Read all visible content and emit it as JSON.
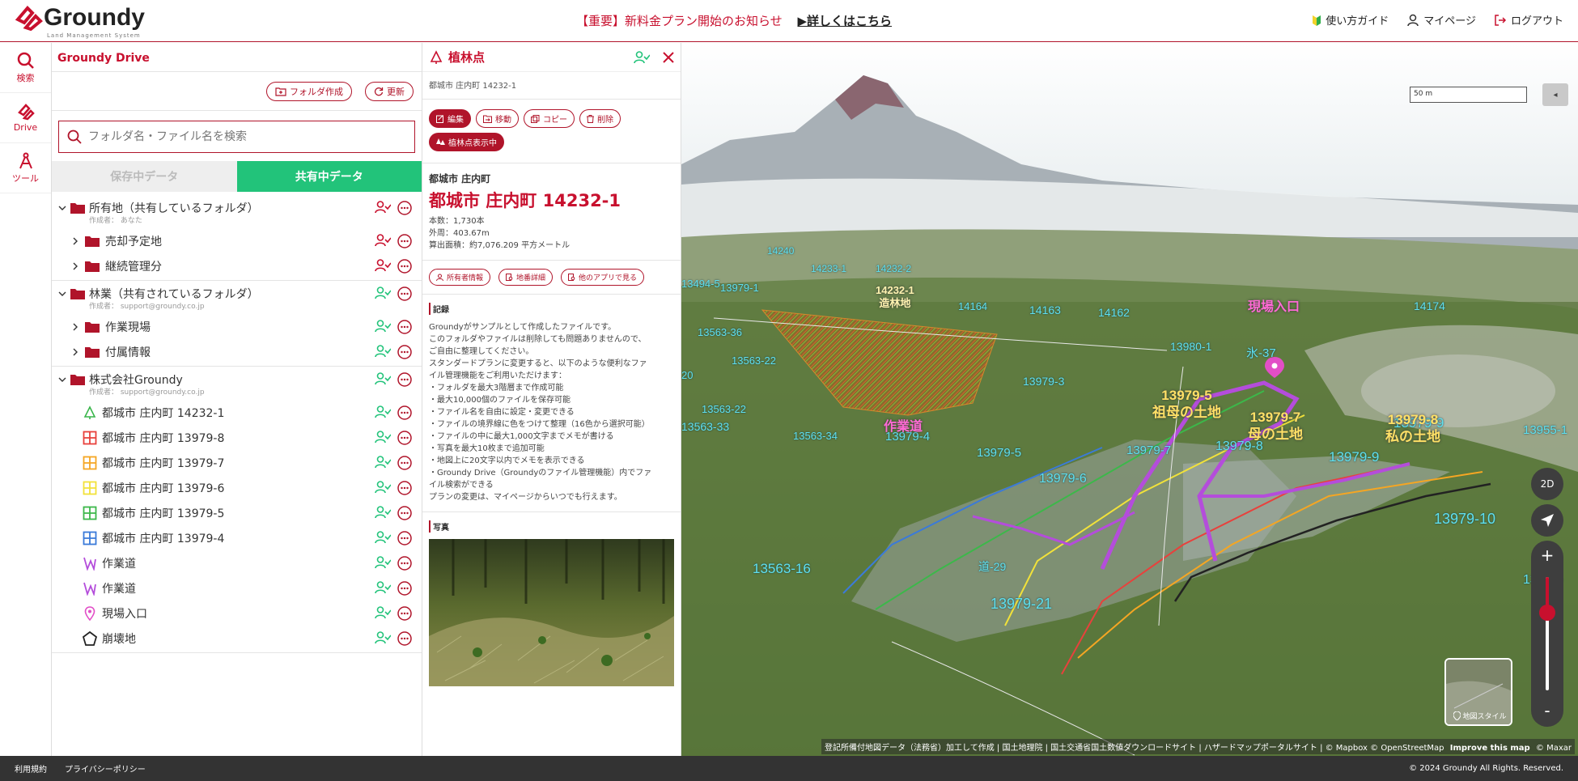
{
  "header": {
    "logo_text": "Groundy",
    "logo_sub": "Land Management System",
    "notice_text": "【重要】新料金プラン開始のお知らせ",
    "notice_link": "▶詳しくはこちら",
    "nav": {
      "guide": "使い方ガイド",
      "mypage": "マイページ",
      "logout": "ログアウト"
    }
  },
  "rail": {
    "search": "検索",
    "drive": "Drive",
    "tools": "ツール"
  },
  "drive": {
    "title": "Groundy Drive",
    "create_folder": "フォルダ作成",
    "refresh": "更新",
    "search_placeholder": "フォルダ名・ファイル名を検索",
    "tab_saved": "保存中データ",
    "tab_shared": "共有中データ",
    "group1": {
      "name": "所有地（共有しているフォルダ）",
      "owner": "作成者： あなた",
      "children": [
        "売却予定地",
        "継続管理分"
      ]
    },
    "group2": {
      "name": "林業（共有されているフォルダ）",
      "owner": "作成者： support@groundy.co.jp",
      "children": [
        "作業現場",
        "付属情報"
      ]
    },
    "group3": {
      "name": "株式会社Groundy",
      "owner": "作成者： support@groundy.co.jp",
      "files": [
        {
          "label": "都城市 庄内町 14232-1",
          "color": "#39b54a"
        },
        {
          "label": "都城市 庄内町 13979-8",
          "color": "#e8413c"
        },
        {
          "label": "都城市 庄内町 13979-7",
          "color": "#f5a623"
        },
        {
          "label": "都城市 庄内町 13979-6",
          "color": "#f2e23a"
        },
        {
          "label": "都城市 庄内町 13979-5",
          "color": "#3cb84a"
        },
        {
          "label": "都城市 庄内町 13979-4",
          "color": "#3b7ad9"
        },
        {
          "label": "作業道",
          "color": "#b44ddb"
        },
        {
          "label": "作業道",
          "color": "#b44ddb"
        },
        {
          "label": "現場入口",
          "color": "#e24ec7"
        },
        {
          "label": "崩壊地",
          "color": "#222222"
        }
      ]
    }
  },
  "detail": {
    "title": "植林点",
    "subtitle": "都城市 庄内町 14232-1",
    "btn_edit": "編集",
    "btn_move": "移動",
    "btn_copy": "コピー",
    "btn_delete": "削除",
    "btn_show": "植林点表示中",
    "pref": "都城市 庄内町",
    "name": "都城市 庄内町 14232-1",
    "count": "本数：1,730本",
    "perimeter": "外周：403.67m",
    "area": "算出面積：約7,076.209 平方メートル",
    "btn_owner": "所有者情報",
    "btn_parcel": "地番詳細",
    "btn_otherapp": "他のアプリで見る",
    "record_label": "記録",
    "record_lines": [
      "Groundyがサンプルとして作成したファイルです。",
      "このフォルダやファイルは削除しても問題ありませんので、",
      "ご自由に整理してください。",
      "スタンダードプランに変更すると、以下のような便利なファ",
      "イル管理機能をご利用いただけます：",
      "・フォルダを最大3階層まで作成可能",
      "・最大10,000個のファイルを保存可能",
      "・ファイル名を自由に設定・変更できる",
      "・ファイルの境界線に色をつけて整理（16色から選択可能）",
      "・ファイルの中に最大1,000文字までメモが書ける",
      "・写真を最大10枚まで追加可能",
      "・地図上に20文字以内でメモを表示できる",
      "・Groundy Drive（Groundyのファイル管理機能）内でファ",
      "イル検索ができる",
      "プランの変更は、マイページからいつでも行えます。"
    ],
    "photo_label": "写真"
  },
  "map": {
    "scale": "50 m",
    "btn_2d": "2D",
    "zoom_in": "+",
    "zoom_out": "-",
    "style_label": "地図スタイル",
    "attribution": "登記所備付地図データ（法務省）加工して作成 | 国土地理院 | 国土交通省国土数値ダウンロードサイト | ハザードマップポータルサイト | © Mapbox © OpenStreetMap",
    "attribution_improve": "Improve this map",
    "attribution_maxar": "© Maxar",
    "labels_cyan": [
      "13979-1",
      "14233-1",
      "14232-2",
      "14164",
      "14163",
      "14162",
      "13563-36",
      "13563-22",
      "13979-3",
      "13980-1",
      "氷-37",
      "13563-22",
      "13979-4",
      "13563-33",
      "13563-34",
      "13979-5",
      "13979-6",
      "13979-7",
      "13979-8",
      "13979-9",
      "13979-9",
      "13979-10",
      "13563-16",
      "13979-21",
      "道-29",
      "14174",
      "14240",
      "13494-5",
      "20",
      "13955-1",
      "13979-"
    ],
    "labels_yellow": [
      "14232-1\n造林地",
      "13979-5\n祖母の土地",
      "13979-7\n母の土地",
      "13979-8\n私の土地"
    ],
    "labels_pink": [
      "現場入口",
      "作業道"
    ]
  },
  "footer": {
    "terms": "利用規約",
    "privacy": "プライバシーポリシー",
    "copyright": "© 2024 Groundy All Rights. Reserved."
  }
}
